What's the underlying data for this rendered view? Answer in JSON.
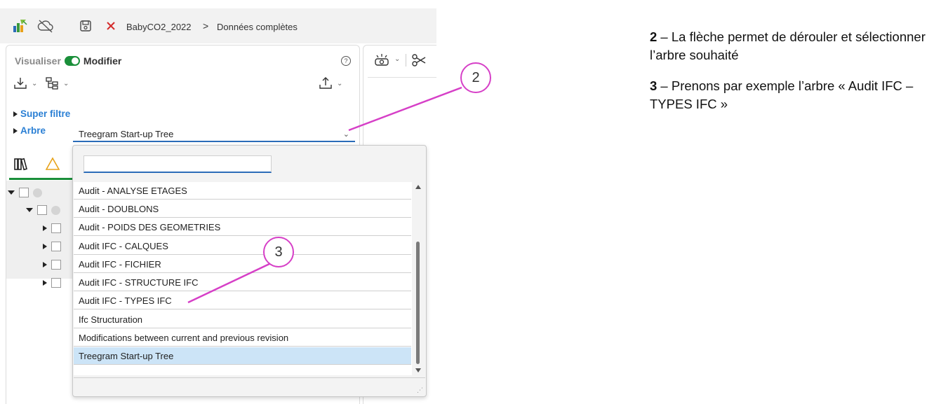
{
  "breadcrumb": {
    "project": "BabyCO2_2022",
    "separator": ">",
    "page": "Données complètes"
  },
  "mode": {
    "view_label": "Visualiser",
    "edit_label": "Modifier"
  },
  "sections": {
    "superfilter_label": "Super filtre",
    "tree_label": "Arbre"
  },
  "tree_select": {
    "value": "Treegram Start-up Tree"
  },
  "dropdown": {
    "search_value": "",
    "items": [
      "Audit - ANALYSE ETAGES",
      "Audit - DOUBLONS",
      "Audit - POIDS DES GEOMETRIES",
      "Audit IFC - CALQUES",
      "Audit IFC - FICHIER",
      "Audit IFC - STRUCTURE IFC",
      "Audit IFC - TYPES IFC",
      "Ifc Structuration",
      "Modifications between current and previous revision",
      "Treegram Start-up Tree"
    ],
    "selected": "Treegram Start-up Tree"
  },
  "callouts": {
    "c2": "2",
    "c3": "3"
  },
  "notes": {
    "n2_num": "2",
    "n2_text": " – La flèche permet de dérouler et sélectionner l’arbre souhaité",
    "n3_num": "3",
    "n3_text": " – Prenons par exemple l’arbre « Audit IFC – TYPES IFC »"
  },
  "colors": {
    "accent_green": "#1a8f3a",
    "link_blue": "#2a7fd4",
    "callout_magenta": "#d63fc7",
    "selected_row": "#cce4f7"
  }
}
